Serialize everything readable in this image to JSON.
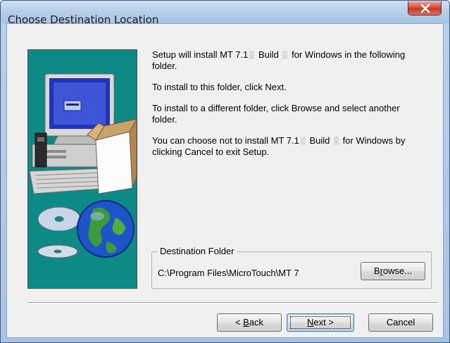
{
  "window": {
    "title": "Choose Destination Location"
  },
  "body": {
    "para1_a": "Setup will install MT 7.1",
    "para1_b": " Build ",
    "para1_c": " for Windows in the following folder.",
    "para2": "To install to this folder, click Next.",
    "para3": "To install to a different folder, click Browse and select another folder.",
    "para4_a": "You can choose not to install MT 7.1",
    "para4_b": " Build ",
    "para4_c": " for Windows by clicking Cancel to exit Setup."
  },
  "destination": {
    "group_label": "Destination Folder",
    "path": "C:\\Program Files\\MicroTouch\\MT 7",
    "browse_pre": "B",
    "browse_ul": "r",
    "browse_post": "owse..."
  },
  "buttons": {
    "back_pre": "< ",
    "back_ul": "B",
    "back_post": "ack",
    "next_ul": "N",
    "next_post": "ext >",
    "cancel": "Cancel"
  },
  "icons": {
    "close": "close-icon",
    "art": "setup-computer-globe-illustration"
  },
  "colors": {
    "art_background": "#0e8a86",
    "close_button": "#c4382a",
    "titlebar": "#b8d0ea"
  }
}
